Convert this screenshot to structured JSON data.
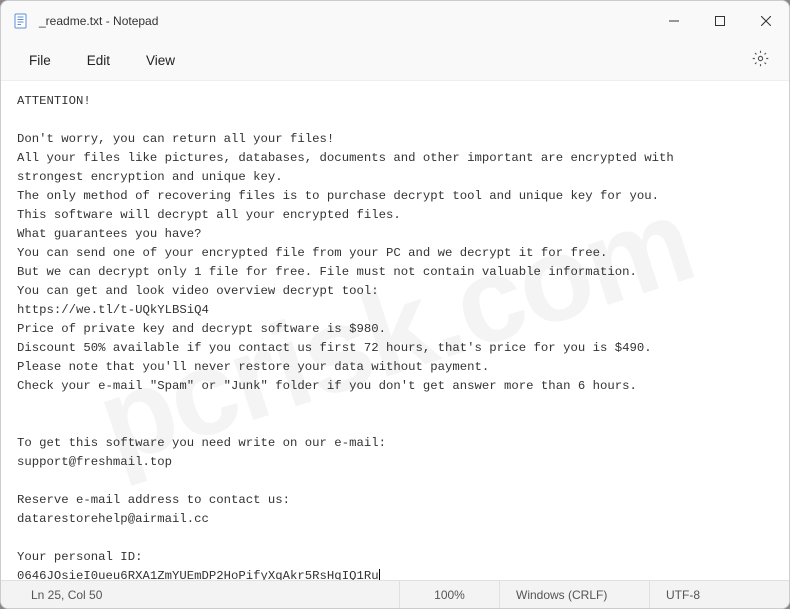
{
  "titlebar": {
    "title": "_readme.txt - Notepad"
  },
  "menubar": {
    "file": "File",
    "edit": "Edit",
    "view": "View"
  },
  "content": {
    "body": "ATTENTION!\n\nDon't worry, you can return all your files!\nAll your files like pictures, databases, documents and other important are encrypted with\nstrongest encryption and unique key.\nThe only method of recovering files is to purchase decrypt tool and unique key for you.\nThis software will decrypt all your encrypted files.\nWhat guarantees you have?\nYou can send one of your encrypted file from your PC and we decrypt it for free.\nBut we can decrypt only 1 file for free. File must not contain valuable information.\nYou can get and look video overview decrypt tool:\nhttps://we.tl/t-UQkYLBSiQ4\nPrice of private key and decrypt software is $980.\nDiscount 50% available if you contact us first 72 hours, that's price for you is $490.\nPlease note that you'll never restore your data without payment.\nCheck your e-mail \"Spam\" or \"Junk\" folder if you don't get answer more than 6 hours.\n\n\nTo get this software you need write on our e-mail:\nsupport@freshmail.top\n\nReserve e-mail address to contact us:\ndatarestorehelp@airmail.cc\n\nYour personal ID:\n0646JOsieI0ueu6RXA1ZmYUEmDP2HoPifyXqAkr5RsHqIQ1Ru"
  },
  "statusbar": {
    "position": "Ln 25, Col 50",
    "zoom": "100%",
    "line_ending": "Windows (CRLF)",
    "encoding": "UTF-8"
  },
  "watermark": "pcrisk.com"
}
